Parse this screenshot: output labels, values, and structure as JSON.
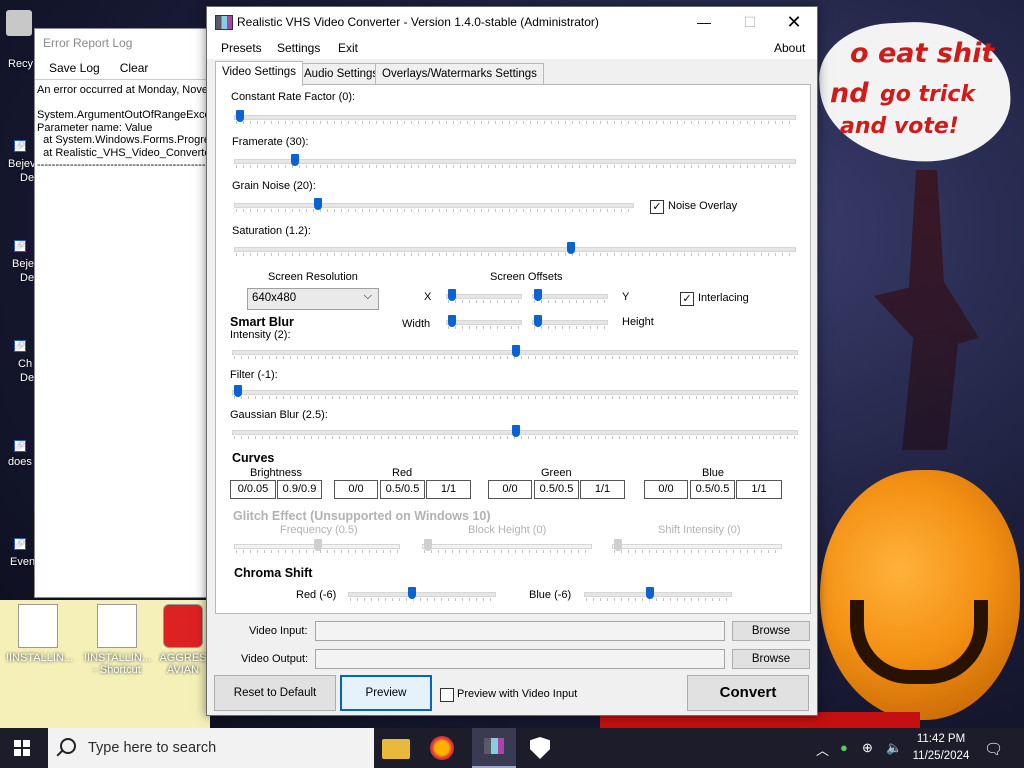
{
  "wallpaper": {
    "line1": "o eat shit",
    "line2": "nd",
    "line2b": "go trick",
    "line3": "and vote!"
  },
  "desktop": {
    "left_labels": [
      "Recy",
      "Bejev",
      "De",
      "Beje",
      "De",
      "Ch",
      "De",
      "does",
      "Even"
    ],
    "icons": [
      {
        "label": "!INSTALLIN..."
      },
      {
        "label": "!INSTALLIN... - Shortcut"
      },
      {
        "label": "AGGRES AVIAN"
      }
    ]
  },
  "error_log": {
    "title": "Error Report Log",
    "save_label": "Save Log",
    "clear_label": "Clear",
    "body": "An error occurred at Monday, Novem\n\nSystem.ArgumentOutOfRangeExcep\nParameter name: Value\n  at System.Windows.Forms.Progres\n  at Realistic_VHS_Video_Converte\n------------------------------------------------------"
  },
  "app": {
    "title": "Realistic VHS Video Converter - Version 1.4.0-stable (Administrator)",
    "menu": {
      "presets": "Presets",
      "settings": "Settings",
      "exit": "Exit",
      "about": "About"
    },
    "tabs": [
      "Video Settings",
      "Audio Settings",
      "Overlays/Watermarks Settings"
    ],
    "sliders": {
      "crf": {
        "label": "Constant Rate Factor (0):",
        "value": 0,
        "min": 0,
        "max": 51
      },
      "framerate": {
        "label": "Framerate (30):",
        "value": 30,
        "min": 0,
        "max": 300
      },
      "grain": {
        "label": "Grain Noise (20):",
        "value": 20,
        "min": 0,
        "max": 100
      },
      "saturation": {
        "label": "Saturation (1.2):",
        "value": 1.2,
        "min": 0,
        "max": 2
      },
      "intensity": {
        "label": "Intensity (2):",
        "value": 2,
        "min": 0,
        "max": 4
      },
      "filter": {
        "label": "Filter (-1):",
        "value": -1,
        "min": -1,
        "max": 10
      },
      "gaussian": {
        "label": "Gaussian Blur (2.5):",
        "value": 2.5,
        "min": 0,
        "max": 5
      }
    },
    "noise_overlay": {
      "label": "Noise Overlay",
      "checked": true
    },
    "screen_resolution": {
      "label": "Screen Resolution",
      "value": "640x480"
    },
    "screen_offsets": {
      "label": "Screen Offsets",
      "x_label": "X",
      "y_label": "Y",
      "width_label": "Width",
      "height_label": "Height"
    },
    "interlacing": {
      "label": "Interlacing",
      "checked": true
    },
    "smart_blur_label": "Smart Blur",
    "curves": {
      "label": "Curves",
      "brightness": {
        "label": "Brightness",
        "values": [
          "0/0.05",
          "0.9/0.9"
        ]
      },
      "red": {
        "label": "Red",
        "values": [
          "0/0",
          "0.5/0.5",
          "1/1"
        ]
      },
      "green": {
        "label": "Green",
        "values": [
          "0/0",
          "0.5/0.5",
          "1/1"
        ]
      },
      "blue": {
        "label": "Blue",
        "values": [
          "0/0",
          "0.5/0.5",
          "1/1"
        ]
      }
    },
    "glitch": {
      "label": "Glitch Effect (Unsupported on Windows 10)",
      "frequency": "Frequency (0.5)",
      "block_height": "Block Height (0)",
      "shift_intensity": "Shift Intensity (0)"
    },
    "chroma": {
      "label": "Chroma Shift",
      "red": "Red (-6)",
      "blue": "Blue (-6)"
    },
    "video_input_label": "Video Input:",
    "video_output_label": "Video Output:",
    "browse_label": "Browse",
    "reset_label": "Reset to Default",
    "preview_label": "Preview",
    "preview_with_input": {
      "label": "Preview with Video Input",
      "checked": false
    },
    "convert_label": "Convert"
  },
  "taskbar": {
    "search_placeholder": "Type here to search",
    "time": "11:42 PM",
    "date": "11/25/2024"
  },
  "colors": {
    "slider_thumb": "#0a63d1",
    "accent": "#0067c0"
  }
}
